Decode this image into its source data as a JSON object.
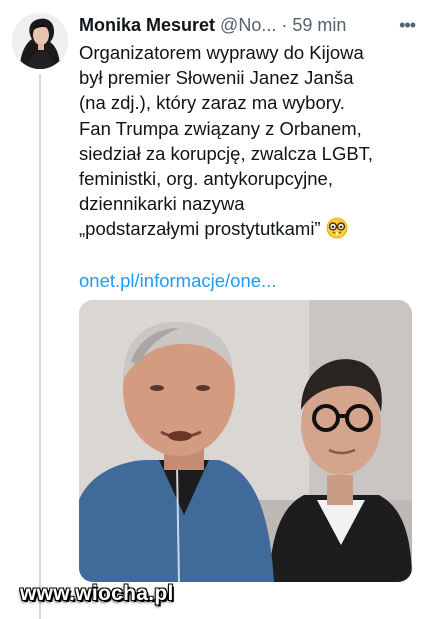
{
  "tweet": {
    "author_name": "Monika Mesuret",
    "handle": "@No...",
    "separator": "·",
    "time": "59 min",
    "more_icon": "more-horizontal-icon",
    "lines": [
      "Organizatorem wyprawy do Kijowa",
      "był premier Słowenii Janez Janša",
      "(na zdj.), który zaraz ma wybory.",
      "Fan Trumpa związany z Orbanem,",
      "siedział za korupcję, zwalcza LGBT,",
      "feministki, org. antykorupcyjne,",
      "dziennikarki nazywa",
      "„podstarzałymi prostytutkami”"
    ],
    "emoji": "nerd-face-emoji",
    "link": "onet.pl/informacje/one..."
  },
  "watermark": "www.wiocha.pl",
  "colors": {
    "link": "#1d9bf0",
    "muted": "#536471",
    "text": "#0f1419"
  }
}
